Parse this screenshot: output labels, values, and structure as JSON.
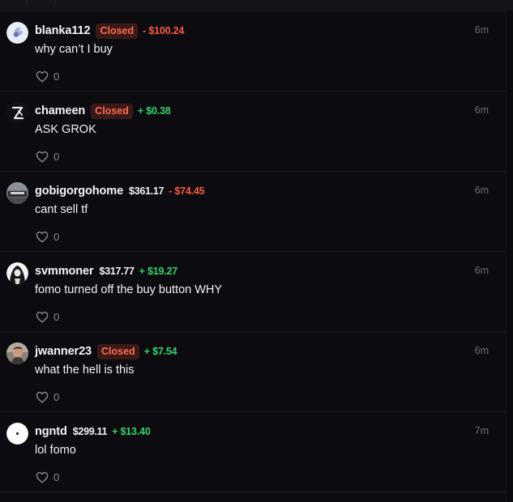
{
  "comments": [
    {
      "username": "blanka112",
      "closed_label": "Closed",
      "holding": "",
      "pnl": "- $100.24",
      "pnl_sign": "neg",
      "time": "6m",
      "message": "why can’t I buy",
      "likes": "0",
      "avatar_icon": "ghost-avatar-icon"
    },
    {
      "username": "chameen",
      "closed_label": "Closed",
      "holding": "",
      "pnl": "+ $0.38",
      "pnl_sign": "pos",
      "time": "6m",
      "message": "ASK GROK",
      "likes": "0",
      "avatar_icon": "grok-logo-avatar-icon"
    },
    {
      "username": "gobigorgohome",
      "closed_label": "",
      "holding": "$361.17",
      "pnl": "- $74.45",
      "pnl_sign": "neg",
      "time": "6m",
      "message": "cant sell tf",
      "likes": "0",
      "avatar_icon": "car-photo-avatar-icon"
    },
    {
      "username": "svmmoner",
      "closed_label": "",
      "holding": "$317.77",
      "pnl": "+ $19.27",
      "pnl_sign": "pos",
      "time": "6m",
      "message": "fomo turned off the buy button WHY",
      "likes": "0",
      "avatar_icon": "hooded-figure-avatar-icon"
    },
    {
      "username": "jwanner23",
      "closed_label": "Closed",
      "holding": "",
      "pnl": "+ $7.54",
      "pnl_sign": "pos",
      "time": "6m",
      "message": "what the hell is this",
      "likes": "0",
      "avatar_icon": "person-photo-avatar-icon"
    },
    {
      "username": "ngntd",
      "closed_label": "",
      "holding": "$299.11",
      "pnl": "+ $13.40",
      "pnl_sign": "pos",
      "time": "7m",
      "message": "lol fomo",
      "likes": "0",
      "avatar_icon": "white-dot-avatar-icon"
    }
  ]
}
